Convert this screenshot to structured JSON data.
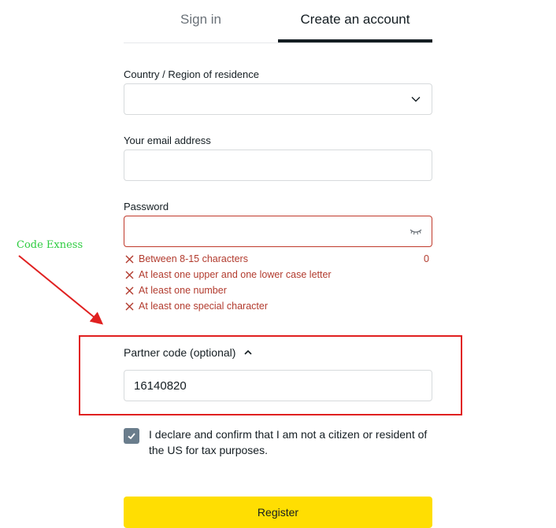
{
  "tabs": {
    "signin": "Sign in",
    "create": "Create an account"
  },
  "form": {
    "country_label": "Country / Region of residence",
    "country_value": "",
    "email_label": "Your email address",
    "email_value": "",
    "password_label": "Password",
    "password_value": "",
    "password_rules": [
      "Between 8-15 characters",
      "At least one upper and one lower case letter",
      "At least one number",
      "At least one special character"
    ],
    "password_length_counter": "0",
    "partner_label": "Partner code (optional)",
    "partner_value": "16140820",
    "declaration": "I declare and confirm that I am not a citizen or resident of the US for tax purposes.",
    "declaration_checked": true,
    "register_label": "Register"
  },
  "annotation": {
    "text": "Code Exness",
    "color": "#2ecc40",
    "box_color": "#e02020"
  },
  "colors": {
    "error": "#b23b2e",
    "button": "#ffde02",
    "checkbox": "#6a7d8c"
  },
  "icons": {
    "country_dropdown": "chevron-down-icon",
    "password_toggle": "eye-closed-icon",
    "rule_status": "x-mark-icon",
    "partner_toggle": "chevron-up-icon",
    "checkbox": "checkmark-icon"
  }
}
